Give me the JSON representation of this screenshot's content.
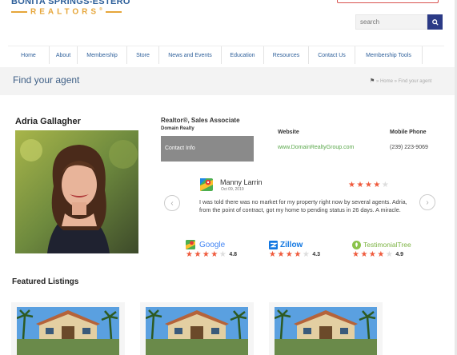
{
  "header": {
    "logo_top": "BONITA SPRINGS-ESTERO",
    "logo_bottom": "REALTORS",
    "logo_mark": "®",
    "search_placeholder": "search",
    "colors": {
      "logo_blue": "#2d5f9a",
      "logo_gold": "#e6a63a",
      "search_button": "#2b3a86"
    }
  },
  "nav": {
    "items": [
      {
        "label": "Home"
      },
      {
        "label": "About"
      },
      {
        "label": "Membership"
      },
      {
        "label": "Store"
      },
      {
        "label": "News and Events"
      },
      {
        "label": "Education"
      },
      {
        "label": "Resources"
      },
      {
        "label": "Contact Us"
      },
      {
        "label": "Membership Tools"
      }
    ]
  },
  "title_band": {
    "title": "Find your agent",
    "breadcrumb": "» Home » Find your agent",
    "home_icon": "home-icon"
  },
  "agent": {
    "name": "Adria Gallagher",
    "role": "Realtor®, Sales Associate",
    "company": "Domain Realty",
    "contact_button": "Contact Info",
    "website_label": "Website",
    "website_value": "www.DomainRealtyGroup.com",
    "phone_label": "Mobile Phone",
    "phone_value": "(239) 223-9069"
  },
  "review": {
    "source_icon": "google-maps-icon",
    "reviewer": "Manny Larrin",
    "date": "Oct 09, 2019",
    "rating": 4,
    "text": "I was told there was no market for my property right now by several agents. Adria, from the point of contract, got my home to pending status in 26 days. A miracle.",
    "prev_icon": "chevron-left-icon",
    "next_icon": "chevron-right-icon",
    "star_color": "#ef5a3c"
  },
  "platforms": [
    {
      "name": "Google",
      "score": "4.8",
      "stars": 4,
      "icon": "google-icon"
    },
    {
      "name": "Zillow",
      "score": "4.3",
      "stars": 4,
      "icon": "zillow-icon"
    },
    {
      "name": "TestimonialTree",
      "score": "4.9",
      "stars": 4,
      "icon": "testimonialtree-icon"
    }
  ],
  "featured": {
    "heading": "Featured Listings",
    "listings": [
      {
        "image": "house-photo"
      },
      {
        "image": "house-photo"
      },
      {
        "image": "house-photo"
      }
    ]
  }
}
